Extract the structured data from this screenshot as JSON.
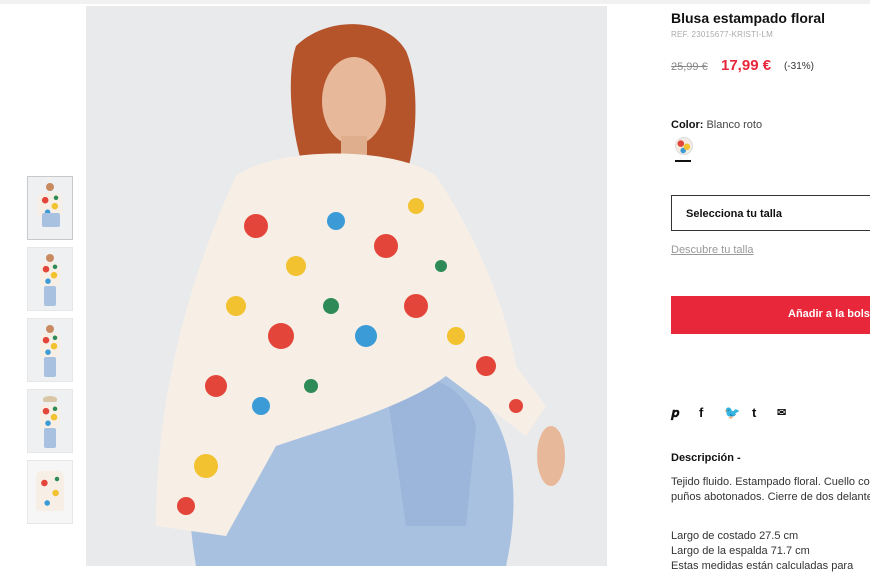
{
  "product": {
    "title": "Blusa estampado floral",
    "ref": "REF. 23015677-KRISTI-LM",
    "old_price": "25,99 €",
    "new_price": "17,99 €",
    "discount": "(-31%)"
  },
  "color": {
    "label": "Color:",
    "value": "Blanco roto"
  },
  "size": {
    "select_label": "Selecciona tu talla",
    "guide_link": "Descubre tu talla"
  },
  "cart": {
    "add_label": "Añadir a la bolsa"
  },
  "share": {
    "icons": [
      "pinterest-icon",
      "facebook-icon",
      "twitter-icon",
      "tumblr-icon",
      "email-icon"
    ],
    "glyphs": [
      "𝒑",
      "f",
      "🐦",
      "t",
      "✉"
    ]
  },
  "description": {
    "title": "Descripción -",
    "text": "Tejido fluido. Estampado floral. Cuello con puños abotonados. Cierre de dos delantera.",
    "lines": [
      "Largo de costado 27.5 cm",
      "Largo de la espalda 71.7 cm",
      "Estas medidas están calculadas para"
    ]
  },
  "gallery": {
    "thumbnail_count": 5
  },
  "colors": {
    "accent": "#e8273b"
  }
}
